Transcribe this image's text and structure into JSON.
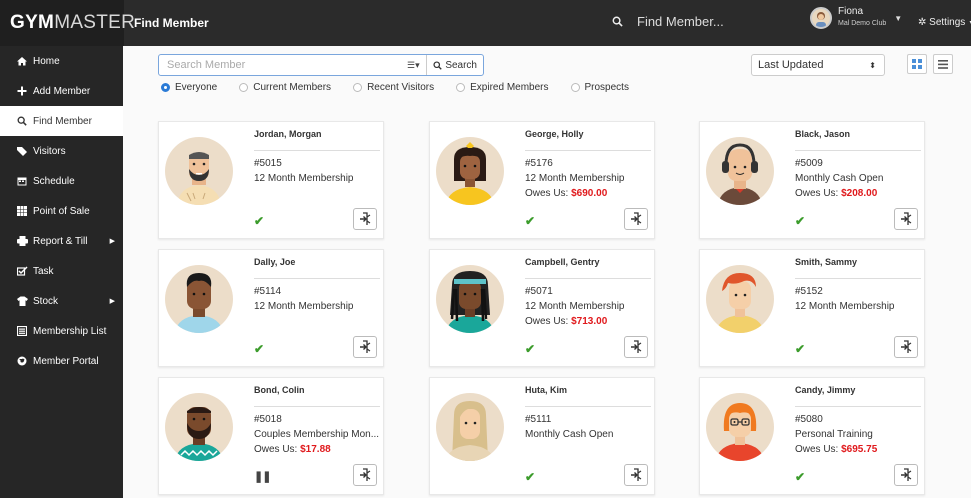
{
  "app": {
    "brand_bold": "GYM",
    "brand_light": "MASTER",
    "page_title": "Find Member"
  },
  "topbar": {
    "search_text": "Find Member...",
    "user_name": "Fiona",
    "club": "Mal Demo Club",
    "settings": "Settings"
  },
  "sidebar": {
    "items": [
      {
        "label": "Home",
        "icon": "home-icon"
      },
      {
        "label": "Add Member",
        "icon": "plus-icon"
      },
      {
        "label": "Find Member",
        "icon": "search-icon",
        "active": true
      },
      {
        "label": "Visitors",
        "icon": "tag-icon"
      },
      {
        "label": "Schedule",
        "icon": "calendar-icon"
      },
      {
        "label": "Point of Sale",
        "icon": "grid-icon"
      },
      {
        "label": "Report & Till",
        "icon": "printer-icon",
        "submenu": true
      },
      {
        "label": "Task",
        "icon": "task-icon"
      },
      {
        "label": "Stock",
        "icon": "shirt-icon",
        "submenu": true
      },
      {
        "label": "Membership List",
        "icon": "list-icon"
      },
      {
        "label": "Member Portal",
        "icon": "globe-icon"
      }
    ]
  },
  "search": {
    "placeholder": "Search Member",
    "value": "",
    "button": "Search"
  },
  "filters": [
    "Everyone",
    "Current Members",
    "Recent Visitors",
    "Expired Members",
    "Prospects"
  ],
  "selected_filter": "Everyone",
  "sort": {
    "selected": "Last Updated"
  },
  "colors": {
    "accent": "#2b7bd6",
    "owes": "#e0191c",
    "ok": "#3c9c2c",
    "topbar": "#2b2b2b",
    "sidebar": "#262626"
  },
  "members": [
    {
      "name": "Jordan, Morgan",
      "number": "#5015",
      "plan": "12 Month Membership",
      "owes": "",
      "status": "ok"
    },
    {
      "name": "George, Holly",
      "number": "#5176",
      "plan": "12 Month Membership",
      "owes": "$690.00",
      "status": "ok"
    },
    {
      "name": "Black, Jason",
      "number": "#5009",
      "plan": "Monthly Cash Open",
      "owes": "$208.00",
      "status": "ok"
    },
    {
      "name": "Dally, Joe",
      "number": "#5114",
      "plan": "12 Month Membership",
      "owes": "",
      "status": "ok"
    },
    {
      "name": "Campbell, Gentry",
      "number": "#5071",
      "plan": "12 Month Membership",
      "owes": "$713.00",
      "status": "ok"
    },
    {
      "name": "Smith, Sammy",
      "number": "#5152",
      "plan": "12 Month Membership",
      "owes": "",
      "status": "ok"
    },
    {
      "name": "Bond, Colin",
      "number": "#5018",
      "plan": "Couples Membership Mon...",
      "owes": "$17.88",
      "status": "paused"
    },
    {
      "name": "Huta, Kim",
      "number": "#5111",
      "plan": "Monthly Cash Open",
      "owes": "",
      "status": "ok"
    },
    {
      "name": "Candy, Jimmy",
      "number": "#5080",
      "plan": "Personal Training",
      "owes": "$695.75",
      "status": "ok"
    }
  ],
  "labels": {
    "owes_prefix": "Owes Us: "
  }
}
